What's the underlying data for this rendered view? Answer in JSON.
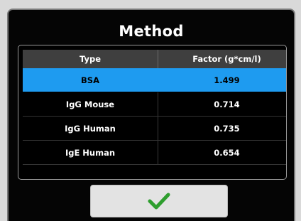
{
  "dialog": {
    "title": "Method"
  },
  "table": {
    "columns": [
      "Type",
      "Factor (g*cm/l)"
    ],
    "rows": [
      {
        "type": "BSA",
        "factor": "1.499",
        "selected": true
      },
      {
        "type": "IgG Mouse",
        "factor": "0.714",
        "selected": false
      },
      {
        "type": "IgG Human",
        "factor": "0.735",
        "selected": false
      },
      {
        "type": "IgE Human",
        "factor": "0.654",
        "selected": false
      }
    ]
  },
  "colors": {
    "selection": "#1e9bf0",
    "confirm_check": "#2e9e2e",
    "background": "#050505"
  },
  "confirm_button": {
    "icon": "check-icon"
  }
}
